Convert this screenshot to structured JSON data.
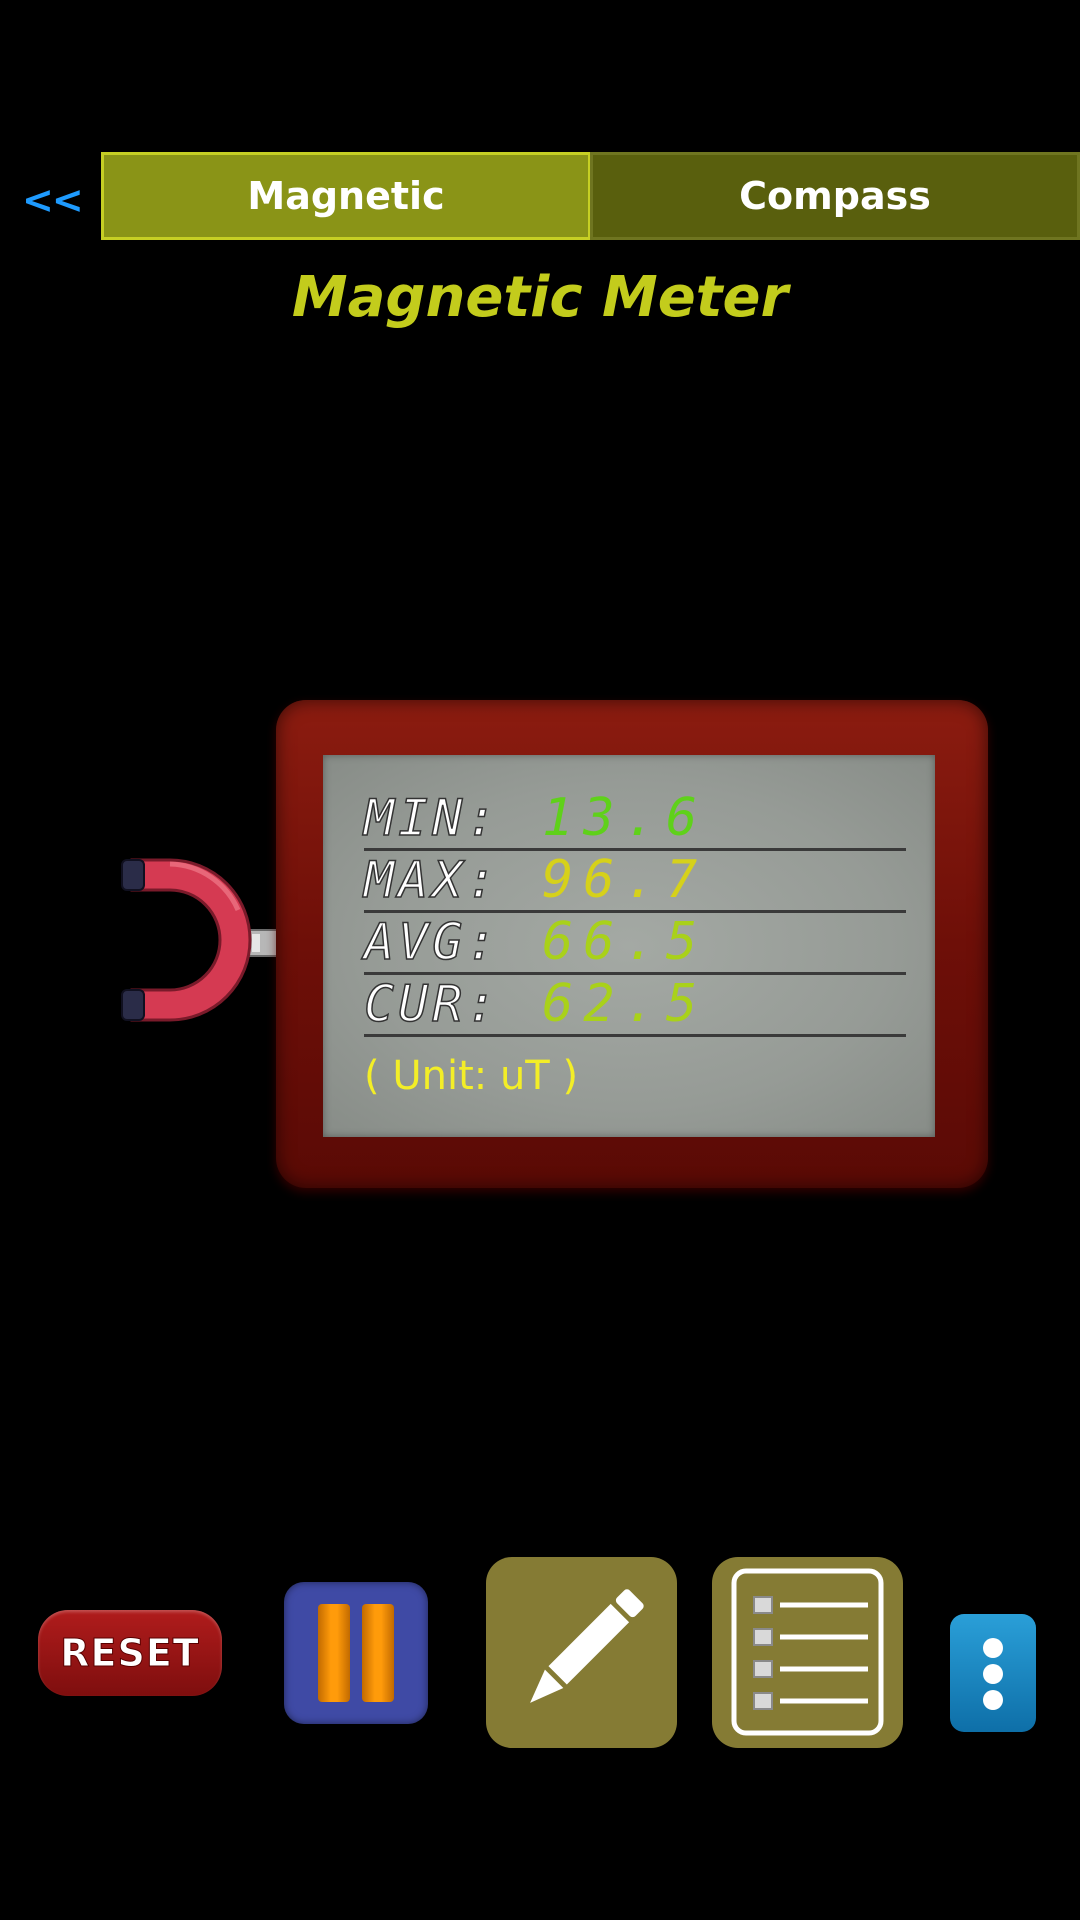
{
  "nav": {
    "back_label": "<<",
    "tabs": [
      {
        "label": "Magnetic",
        "active": true
      },
      {
        "label": "Compass",
        "active": false
      }
    ]
  },
  "title": "Magnetic Meter",
  "meter": {
    "readings": [
      {
        "label": "MIN:",
        "value": "13.6",
        "color": "#5fd11a"
      },
      {
        "label": "MAX:",
        "value": "96.7",
        "color": "#d6d11a"
      },
      {
        "label": "AVG:",
        "value": "66.5",
        "color": "#a9d11a"
      },
      {
        "label": "CUR:",
        "value": "62.5",
        "color": "#a9d11a"
      }
    ],
    "unit_text": "( Unit: uT )"
  },
  "toolbar": {
    "reset_label": "RESET",
    "icons": [
      "pause-icon",
      "pencil-icon",
      "list-icon",
      "more-vertical-icon"
    ]
  },
  "colors": {
    "accent": "#c3cc1c",
    "tab_active": "#8a9417",
    "tab_inactive": "#595f0d",
    "back_link": "#1e9bff",
    "frame": "#7a1409"
  }
}
